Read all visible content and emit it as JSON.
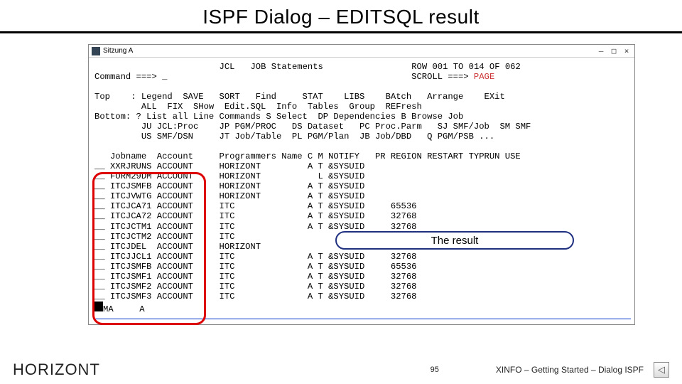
{
  "title": "ISPF Dialog – EDITSQL result",
  "titlebar": {
    "label": "Sitzung A",
    "min": "–",
    "max": "□",
    "close": "×"
  },
  "header": {
    "center_left": "JCL",
    "center_mid": "JOB Statements",
    "row": "ROW 001 TO 014 OF 062",
    "scroll_label": "SCROLL ===> ",
    "scroll_val": "PAGE",
    "cmd_label": "Command ===> _"
  },
  "menu": {
    "top_label": "Top    :",
    "top1": " Legend  SAVE   SORT   Find     STAT    LIBS    BAtch   Arrange    EXit",
    "top2": " ALL  FIX  SHow  Edit.SQL  Info  Tables  Group  REFresh",
    "bot_label": "Bottom:",
    "bot1": " ? List all Line Commands S Select  DP Dependencies B Browse Job",
    "bot2": " JU JCL:Proc    JP PGM/PROC   DS Dataset   PC Proc.Parm   SJ SMF/Job  SM SMF",
    "bot3": " US SMF/DSN     JT Job/Table  PL PGM/Plan  JB Job/DBD   Q PGM/PSB ..."
  },
  "cols": "   Jobname  Account     Programmers Name C M NOTIFY   PR REGION RESTART TYPRUN USE",
  "rows": [
    "__ XXRJRUNS ACCOUNT     HORIZONT         A T &SYSUID",
    "__ FORM29DM ACCOUNT     HORIZONT           L &SYSUID",
    "__ ITCJSMFB ACCOUNT     HORIZONT         A T &SYSUID",
    "__ ITCJVWTG ACCOUNT     HORIZONT         A T &SYSUID",
    "__ ITCJCA71 ACCOUNT     ITC              A T &SYSUID     65536",
    "__ ITCJCA72 ACCOUNT     ITC              A T &SYSUID     32768",
    "__ ITCJCTM1 ACCOUNT     ITC              A T &SYSUID     32768",
    "__ ITCJCTM2 ACCOUNT     ITC",
    "__ ITCJDEL  ACCOUNT     HORIZONT",
    "__ ITCJJCL1 ACCOUNT     ITC              A T &SYSUID     32768",
    "__ ITCJSMFB ACCOUNT     ITC              A T &SYSUID     65536",
    "__ ITCJSMF1 ACCOUNT     ITC              A T &SYSUID     32768",
    "__ ITCJSMF2 ACCOUNT     ITC              A T &SYSUID     32768",
    "__ ITCJSMF3 ACCOUNT     ITC              A T &SYSUID     32768"
  ],
  "status_left": "MA",
  "status_a": "A",
  "callout": "The result",
  "footer": {
    "brand": "HORIZONT",
    "page": "95",
    "course": "XINFO – Getting Started – Dialog ISPF",
    "nav": "◁"
  }
}
